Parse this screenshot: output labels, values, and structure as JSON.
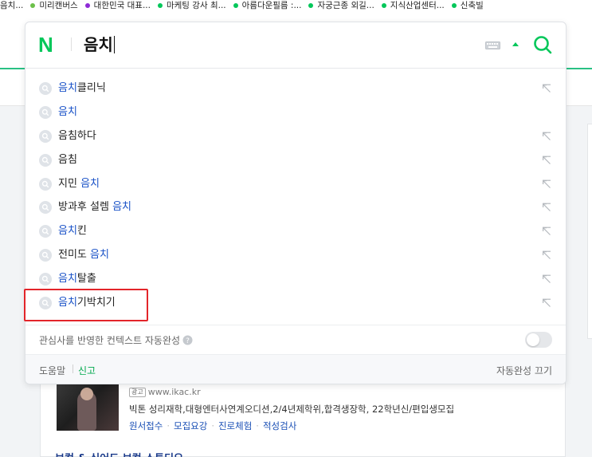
{
  "bookmarks": [
    {
      "label": "음치...",
      "dot": ""
    },
    {
      "label": "미리캔버스",
      "dot": "#6cc04a"
    },
    {
      "label": "대한민국 대표...",
      "dot": "#8e2bd6"
    },
    {
      "label": "마케팅 강사 최...",
      "dot": "#03c75a"
    },
    {
      "label": "아름다운필름 :...",
      "dot": "#03c75a"
    },
    {
      "label": "자궁근종 외길...",
      "dot": "#03c75a"
    },
    {
      "label": "지식산업센터...",
      "dot": "#03c75a"
    },
    {
      "label": "신축빌",
      "dot": "#03c75a"
    }
  ],
  "search": {
    "logo": "N",
    "query": "음치"
  },
  "suggestions": [
    {
      "highlight": "음치",
      "rest_before": "",
      "rest": "클리닉",
      "arrow": true
    },
    {
      "highlight": "음치",
      "rest_before": "",
      "rest": "",
      "arrow": false
    },
    {
      "highlight": "",
      "rest_before": "음침하다",
      "rest": "",
      "arrow": true
    },
    {
      "highlight": "",
      "rest_before": "음침",
      "rest": "",
      "arrow": true
    },
    {
      "highlight": "음치",
      "rest_before": "지민 ",
      "rest": "",
      "arrow": true
    },
    {
      "highlight": "음치",
      "rest_before": "방과후 설렘 ",
      "rest": "",
      "arrow": true
    },
    {
      "highlight": "음치",
      "rest_before": "",
      "rest": "킨",
      "arrow": true
    },
    {
      "highlight": "음치",
      "rest_before": "전미도 ",
      "rest": "",
      "arrow": true
    },
    {
      "highlight": "음치",
      "rest_before": "",
      "rest": "탈출",
      "arrow": true
    },
    {
      "highlight": "음치",
      "rest_before": "",
      "rest": "기박치기",
      "arrow": true
    }
  ],
  "context": {
    "label": "관심사를 반영한 컨텍스트 자동완성",
    "toggle_on": false
  },
  "footer": {
    "help": "도움말",
    "report": "신고",
    "turn_off": "자동완성 끄기"
  },
  "ad": {
    "badge": "광고",
    "url": "www.ikac.kr",
    "description": "빅톤 성리재학,대형엔터사연계오디션,2/4년제학위,합격생장학, 22학년신/편입생모집",
    "links": [
      "원서접수",
      "모집요강",
      "진로체험",
      "적성검사"
    ],
    "cut_title": "보컬 & 싱어드 보컬 스튜디오"
  },
  "colors": {
    "brand": "#03c75a",
    "highlight": "#1a52c7",
    "annotation": "#e3252a"
  }
}
